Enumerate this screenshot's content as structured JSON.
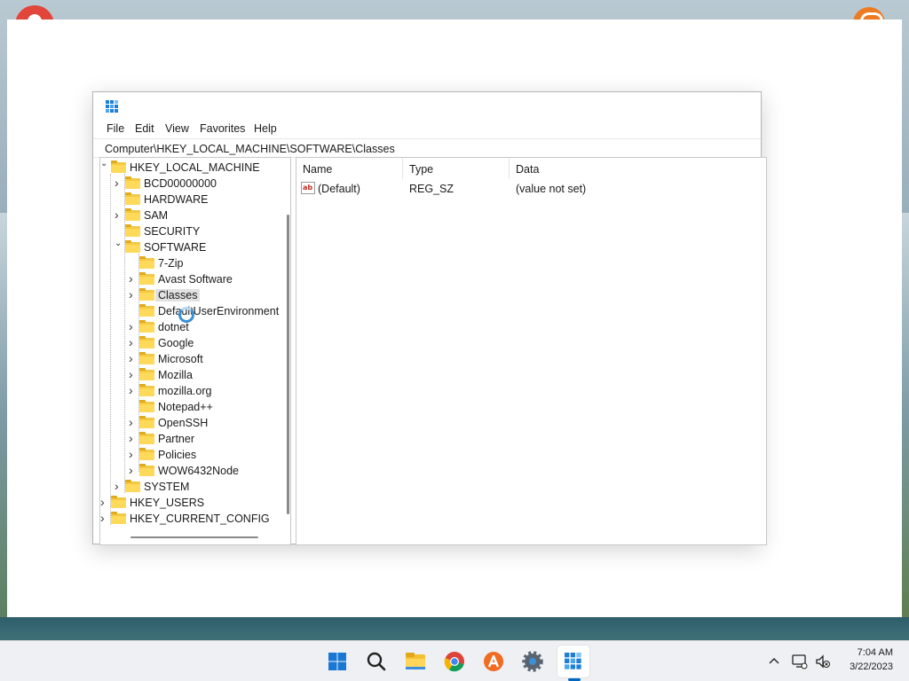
{
  "window": {
    "menu": [
      "File",
      "Edit",
      "View",
      "Favorites",
      "Help"
    ],
    "address": "Computer\\HKEY_LOCAL_MACHINE\\SOFTWARE\\Classes"
  },
  "tree": [
    {
      "label": "HKEY_LOCAL_MACHINE",
      "level": 0,
      "expander": "expanded"
    },
    {
      "label": "BCD00000000",
      "level": 1,
      "expander": "collapsed"
    },
    {
      "label": "HARDWARE",
      "level": 1,
      "expander": "none"
    },
    {
      "label": "SAM",
      "level": 1,
      "expander": "collapsed"
    },
    {
      "label": "SECURITY",
      "level": 1,
      "expander": "none"
    },
    {
      "label": "SOFTWARE",
      "level": 1,
      "expander": "expanded"
    },
    {
      "label": "7-Zip",
      "level": 2,
      "expander": "none"
    },
    {
      "label": "Avast Software",
      "level": 2,
      "expander": "collapsed"
    },
    {
      "label": "Classes",
      "level": 2,
      "expander": "collapsed",
      "selected": true
    },
    {
      "label": "DefaultUserEnvironment",
      "level": 2,
      "expander": "none"
    },
    {
      "label": "dotnet",
      "level": 2,
      "expander": "collapsed"
    },
    {
      "label": "Google",
      "level": 2,
      "expander": "collapsed"
    },
    {
      "label": "Microsoft",
      "level": 2,
      "expander": "collapsed"
    },
    {
      "label": "Mozilla",
      "level": 2,
      "expander": "collapsed"
    },
    {
      "label": "mozilla.org",
      "level": 2,
      "expander": "collapsed"
    },
    {
      "label": "Notepad++",
      "level": 2,
      "expander": "none"
    },
    {
      "label": "OpenSSH",
      "level": 2,
      "expander": "collapsed"
    },
    {
      "label": "Partner",
      "level": 2,
      "expander": "collapsed"
    },
    {
      "label": "Policies",
      "level": 2,
      "expander": "collapsed"
    },
    {
      "label": "WOW6432Node",
      "level": 2,
      "expander": "collapsed"
    },
    {
      "label": "SYSTEM",
      "level": 1,
      "expander": "collapsed"
    },
    {
      "label": "HKEY_USERS",
      "level": 0,
      "expander": "collapsed"
    },
    {
      "label": "HKEY_CURRENT_CONFIG",
      "level": 0,
      "expander": "collapsed"
    }
  ],
  "list": {
    "columns": [
      "Name",
      "Type",
      "Data"
    ],
    "rows": [
      {
        "icon": "string-value-icon",
        "icon_text": "ab",
        "name": "(Default)",
        "type": "REG_SZ",
        "data": "(value not set)"
      }
    ]
  },
  "taskbar": {
    "apps": [
      "start-icon",
      "search-icon",
      "file-explorer-icon",
      "chrome-icon",
      "avast-icon",
      "settings-icon",
      "regedit-icon"
    ],
    "active": "regedit-icon"
  },
  "tray": {
    "time": "7:04 AM",
    "date": "3/22/2023",
    "icons": [
      "chevron-up-icon",
      "network-icon",
      "volume-muted-icon"
    ]
  },
  "colors": {
    "folder": "#f4c842",
    "accent": "#0067c0",
    "selection": "#e1e1e1"
  }
}
